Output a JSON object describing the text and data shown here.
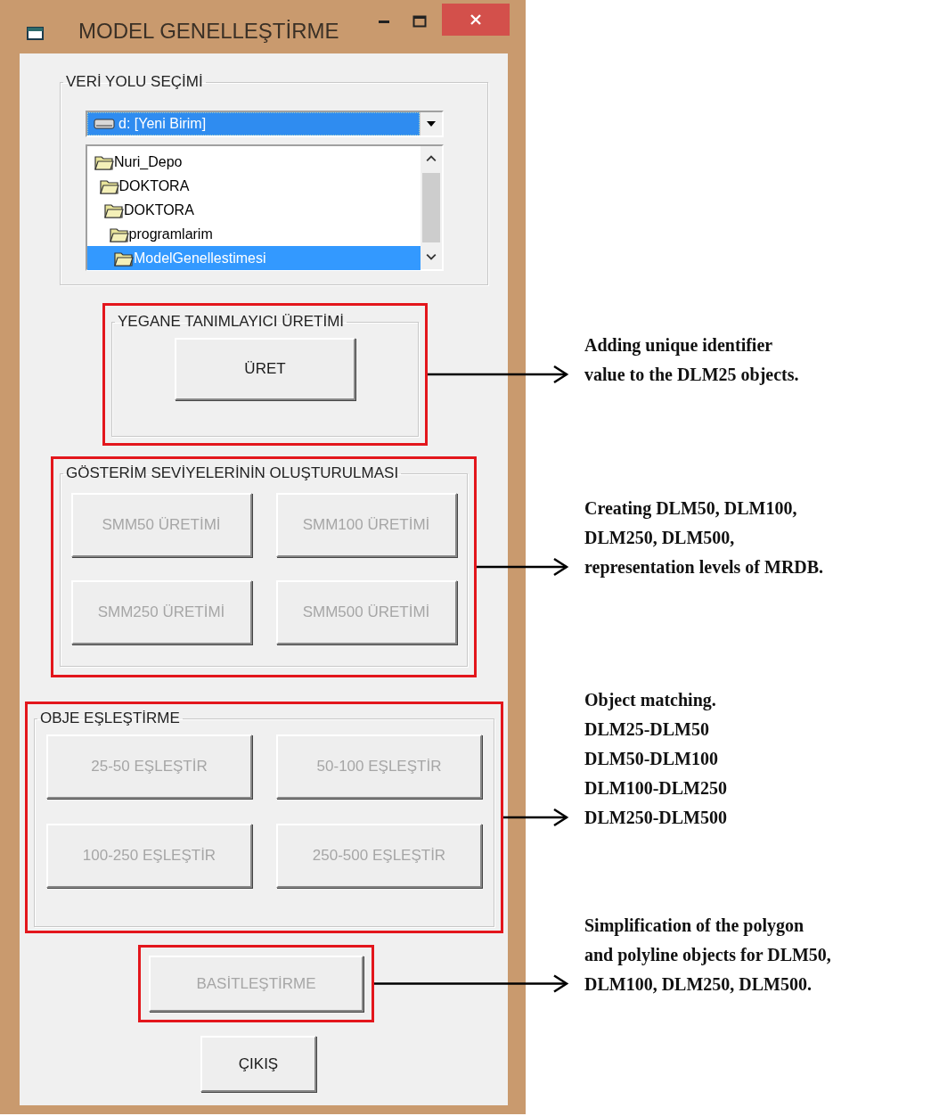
{
  "window": {
    "title": "MODEL GENELLEŞTİRME"
  },
  "sections": [
    {
      "kind": "path_group",
      "title": "VERİ YOLU SEÇİMİ",
      "highlighted": false,
      "drive": {
        "value": "d: [Yeni Birim]",
        "selected": true
      },
      "folders": [
        {
          "label": "Nuri_Depo",
          "selected": false,
          "children": [
            {
              "label": "DOKTORA",
              "selected": false,
              "children": [
                {
                  "label": "DOKTORA",
                  "selected": false,
                  "children": [
                    {
                      "label": "programlarim",
                      "selected": false,
                      "children": [
                        {
                          "label": "ModelGenellestimesi",
                          "selected": true
                        }
                      ]
                    }
                  ]
                }
              ]
            }
          ]
        }
      ]
    },
    {
      "kind": "button_group",
      "title": "YEGANE TANIMLAYICI ÜRETİMİ",
      "highlighted": true,
      "buttons": [
        {
          "label": "ÜRET",
          "disabled": false
        }
      ],
      "note": [
        "Adding unique identifier",
        "value to the DLM25 objects."
      ]
    },
    {
      "kind": "button_group",
      "title": "GÖSTERİM SEVİYELERİNİN OLUŞTURULMASI",
      "highlighted": true,
      "buttons": [
        {
          "label": "SMM50 ÜRETİMİ",
          "disabled": true
        },
        {
          "label": "SMM100 ÜRETİMİ",
          "disabled": true
        },
        {
          "label": "SMM250 ÜRETİMİ",
          "disabled": true
        },
        {
          "label": "SMM500 ÜRETİMİ",
          "disabled": true
        }
      ],
      "note": [
        "Creating DLM50, DLM100,",
        "DLM250, DLM500,",
        "representation levels of MRDB."
      ]
    },
    {
      "kind": "button_group",
      "title": "OBJE EŞLEŞTİRME",
      "highlighted": true,
      "buttons": [
        {
          "label": "25-50 EŞLEŞTİR",
          "disabled": true
        },
        {
          "label": "50-100 EŞLEŞTİR",
          "disabled": true
        },
        {
          "label": "100-250 EŞLEŞTİR",
          "disabled": true
        },
        {
          "label": "250-500 EŞLEŞTİR",
          "disabled": true
        }
      ],
      "note": [
        "Object matching.",
        "DLM25-DLM50",
        "DLM50-DLM100",
        "DLM100-DLM250",
        "DLM250-DLM500"
      ]
    },
    {
      "kind": "button",
      "highlighted": true,
      "button": {
        "label": "BASİTLEŞTİRME",
        "disabled": true
      },
      "note": [
        "Simplification of the polygon",
        "and polyline objects for DLM50,",
        "DLM100, DLM250, DLM500."
      ]
    },
    {
      "kind": "button",
      "highlighted": false,
      "button": {
        "label": "ÇIKIŞ",
        "disabled": false
      }
    }
  ]
}
